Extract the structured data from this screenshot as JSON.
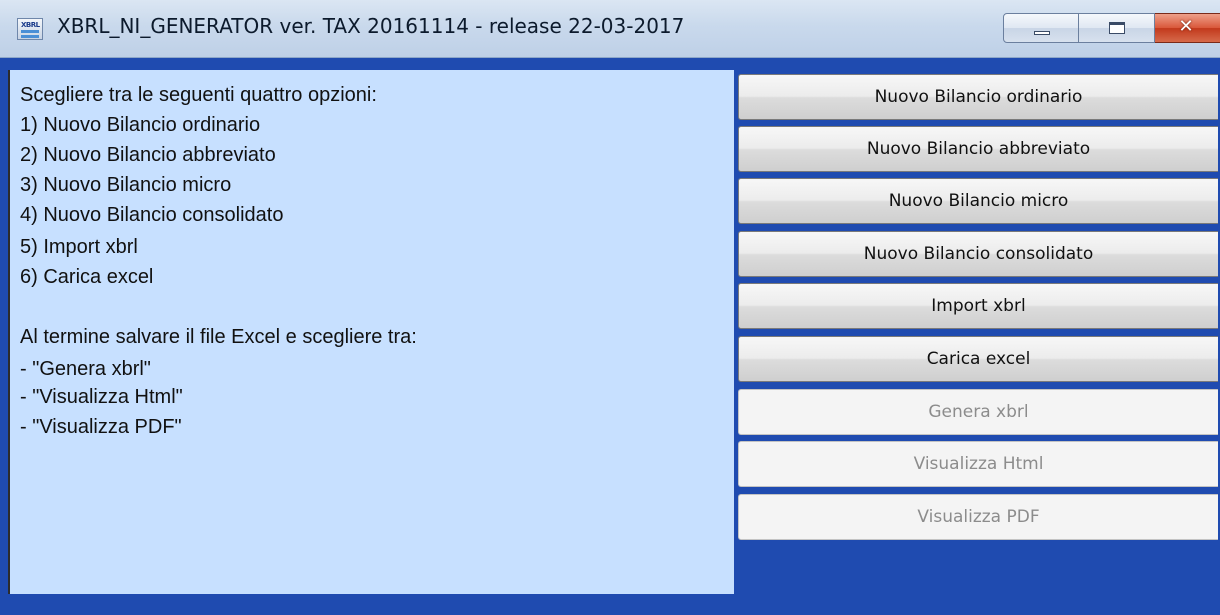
{
  "window": {
    "title": "XBRL_NI_GENERATOR ver. TAX 20161114 - release 22-03-2017",
    "icon": "xbrl-app-icon",
    "icon_text": "XBRL",
    "controls": {
      "minimize": "minimize-icon",
      "maximize": "maximize-icon",
      "close_label": "✕"
    }
  },
  "instructions": {
    "lines": [
      "Scegliere tra le seguenti quattro opzioni:",
      "1) Nuovo Bilancio ordinario",
      "2) Nuovo Bilancio abbreviato",
      "3) Nuovo Bilancio micro",
      "4) Nuovo Bilancio consolidato",
      "5) Import xbrl",
      "6) Carica excel",
      "Al termine salvare il file Excel e scegliere tra:",
      "- \"Genera xbrl\"",
      "- \"Visualizza Html\"",
      "- \"Visualizza PDF\""
    ]
  },
  "buttons": [
    {
      "label": "Nuovo Bilancio ordinario",
      "enabled": true
    },
    {
      "label": "Nuovo Bilancio abbreviato",
      "enabled": true
    },
    {
      "label": "Nuovo Bilancio micro",
      "enabled": true
    },
    {
      "label": "Nuovo Bilancio consolidato",
      "enabled": true
    },
    {
      "label": "Import xbrl",
      "enabled": true
    },
    {
      "label": "Carica excel",
      "enabled": true
    },
    {
      "label": "Genera xbrl",
      "enabled": false
    },
    {
      "label": "Visualizza Html",
      "enabled": false
    },
    {
      "label": "Visualizza PDF",
      "enabled": false
    }
  ],
  "colors": {
    "window_background": "#1f4bb0",
    "panel_background": "#c7e0ff",
    "disabled_text": "#8c8c8c"
  }
}
